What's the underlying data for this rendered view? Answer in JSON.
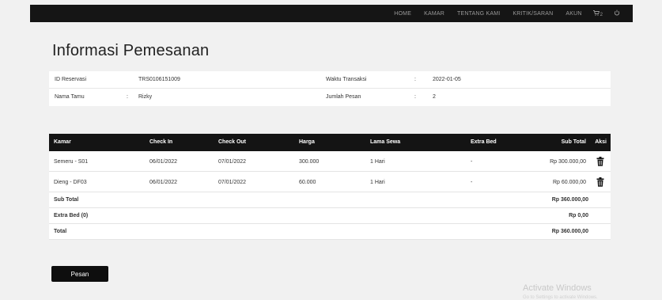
{
  "nav": {
    "items": [
      "HOME",
      "KAMAR",
      "TENTANG KAMI",
      "KRITIK/SARAN",
      "AKUN"
    ],
    "cart_count": "2"
  },
  "page": {
    "title": "Informasi Pemesanan"
  },
  "info": {
    "id_label": "ID Reservasi",
    "id_value": "TRS0106151009",
    "waktu_label": "Waktu Transaksi",
    "waktu_value": "2022-01-05",
    "nama_label": "Nama Tamu",
    "nama_value": "Rizky",
    "jumlah_label": "Jumlah Pesan",
    "jumlah_value": "2",
    "colon": ":"
  },
  "table": {
    "headers": [
      "Kamar",
      "Check In",
      "Check Out",
      "Harga",
      "Lama Sewa",
      "Extra Bed",
      "Sub Total",
      "Aksi"
    ],
    "rows": [
      {
        "kamar": "Semeru - S01",
        "check_in": "06/01/2022",
        "check_out": "07/01/2022",
        "harga": "300.000",
        "lama": "1 Hari",
        "extra": "-",
        "subtotal": "Rp 300.000,00"
      },
      {
        "kamar": "Dieng - DF03",
        "check_in": "06/01/2022",
        "check_out": "07/01/2022",
        "harga": "60.000",
        "lama": "1 Hari",
        "extra": "-",
        "subtotal": "Rp 60.000,00"
      }
    ],
    "summary": [
      {
        "label": "Sub Total",
        "value": "Rp 360.000,00"
      },
      {
        "label": "Extra Bed (0)",
        "value": "Rp 0,00"
      },
      {
        "label": "Total",
        "value": "Rp 360.000,00"
      }
    ]
  },
  "actions": {
    "pesan_label": "Pesan"
  },
  "watermark": {
    "title": "Activate Windows",
    "subtitle": "Go to Settings to activate Windows."
  },
  "icons": {
    "cart": "cart-icon",
    "logout": "power-icon",
    "delete": "trash-icon"
  }
}
